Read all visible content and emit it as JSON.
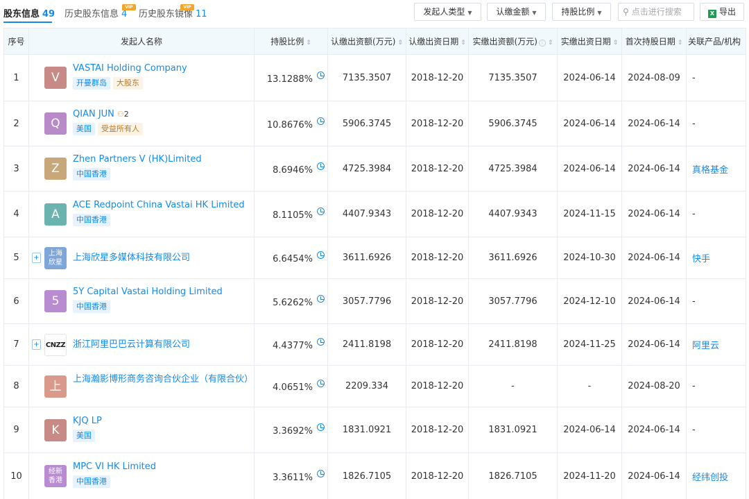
{
  "tabs": [
    {
      "label": "股东信息",
      "count": "49",
      "active": true
    },
    {
      "label": "历史股东信息",
      "count": "4",
      "vip": "VIP"
    },
    {
      "label": "历史股东镜像",
      "count": "11",
      "vip": "VIP"
    }
  ],
  "toolbar": {
    "filter_type": "发起人类型",
    "filter_amount": "认缴金额",
    "filter_ratio": "持股比例",
    "search_placeholder": "点击进行搜索",
    "export_label": "导出",
    "export_icon": "excel-icon"
  },
  "columns": [
    "序号",
    "发起人名称",
    "持股比例",
    "认缴出资额(万元)",
    "认缴出资日期",
    "实缴出资额(万元)",
    "实缴出资日期",
    "首次持股日期",
    "关联产品/机构"
  ],
  "rows": [
    {
      "index": "1",
      "logo_text": "V",
      "logo_color": "#c88a86",
      "name": "VASTAI Holding Company",
      "tags": [
        {
          "text": "开曼群岛",
          "style": "blue"
        },
        {
          "text": "大股东",
          "style": "gold"
        }
      ],
      "ratio": "13.1288%",
      "sub_amount": "7135.3507",
      "sub_date": "2018-12-20",
      "paid_amount": "7135.3507",
      "paid_date": "2024-06-14",
      "first_date": "2024-08-09",
      "related": "-"
    },
    {
      "index": "2",
      "logo_text": "Q",
      "logo_color": "#b88ac9",
      "name": "QIAN JUN",
      "person_count": "2",
      "tags": [
        {
          "text": "美国",
          "style": "blue"
        },
        {
          "text": "受益所有人",
          "style": "gold"
        }
      ],
      "ratio": "10.8676%",
      "sub_amount": "5906.3745",
      "sub_date": "2018-12-20",
      "paid_amount": "5906.3745",
      "paid_date": "2024-06-14",
      "first_date": "2024-06-14",
      "related": "-"
    },
    {
      "index": "3",
      "logo_text": "Z",
      "logo_color": "#c8a77a",
      "name": "Zhen Partners V (HK)Limited",
      "tags": [
        {
          "text": "中国香港",
          "style": "blue"
        }
      ],
      "ratio": "8.6946%",
      "sub_amount": "4725.3984",
      "sub_date": "2018-12-20",
      "paid_amount": "4725.3984",
      "paid_date": "2024-06-14",
      "first_date": "2024-06-14",
      "related": "真格基金"
    },
    {
      "index": "4",
      "logo_text": "A",
      "logo_color": "#6bb3ae",
      "name": "ACE Redpoint China Vastai HK Limited",
      "tags": [
        {
          "text": "中国香港",
          "style": "blue"
        }
      ],
      "ratio": "8.1105%",
      "sub_amount": "4407.9343",
      "sub_date": "2018-12-20",
      "paid_amount": "4407.9343",
      "paid_date": "2024-11-15",
      "first_date": "2024-06-14",
      "related": "-"
    },
    {
      "index": "5",
      "logo_text": "上海\n欣星",
      "logo_color": "#7ea6d8",
      "logo_small": true,
      "expand": "+",
      "name": "上海欣星多媒体科技有限公司",
      "tags": [],
      "ratio": "6.6454%",
      "sub_amount": "3611.6926",
      "sub_date": "2018-12-20",
      "paid_amount": "3611.6926",
      "paid_date": "2024-10-30",
      "first_date": "2024-06-14",
      "related": "快手"
    },
    {
      "index": "6",
      "logo_text": "5",
      "logo_color": "#b98bd0",
      "name": "5Y Capital Vastai Holding Limited",
      "tags": [
        {
          "text": "中国香港",
          "style": "blue"
        }
      ],
      "ratio": "5.6262%",
      "sub_amount": "3057.7796",
      "sub_date": "2018-12-20",
      "paid_amount": "3057.7796",
      "paid_date": "2024-12-10",
      "first_date": "2024-06-14",
      "related": "-"
    },
    {
      "index": "7",
      "logo_text": "CNZZ",
      "logo_color": "#ffffff",
      "logo_cnzz": true,
      "expand": "+",
      "name": "浙江阿里巴巴云计算有限公司",
      "tags": [],
      "ratio": "4.4377%",
      "sub_amount": "2411.8198",
      "sub_date": "2018-12-20",
      "paid_amount": "2411.8198",
      "paid_date": "2024-11-25",
      "first_date": "2024-06-14",
      "related": "阿里云"
    },
    {
      "index": "8",
      "logo_text": "上",
      "logo_color": "#d99a8c",
      "name": "上海瀚影博形商务咨询合伙企业（有限合伙）",
      "tags": [],
      "ratio": "4.0651%",
      "sub_amount": "2209.334",
      "sub_date": "2018-12-20",
      "paid_amount": "-",
      "paid_date": "-",
      "first_date": "2024-08-20",
      "related": "-"
    },
    {
      "index": "9",
      "logo_text": "K",
      "logo_color": "#c88a86",
      "name": "KJQ LP",
      "tags": [
        {
          "text": "美国",
          "style": "blue"
        }
      ],
      "ratio": "3.3692%",
      "sub_amount": "1831.0921",
      "sub_date": "2018-12-20",
      "paid_amount": "1831.0921",
      "paid_date": "2024-06-14",
      "first_date": "2024-06-14",
      "related": "-"
    },
    {
      "index": "10",
      "logo_text": "经新\n香港",
      "logo_color": "#b98bd0",
      "logo_small": true,
      "name": "MPC VI HK Limited",
      "tags": [
        {
          "text": "中国香港",
          "style": "blue"
        }
      ],
      "ratio": "3.3611%",
      "sub_amount": "1826.7105",
      "sub_date": "2018-12-20",
      "paid_amount": "1826.7105",
      "paid_date": "2024-11-20",
      "first_date": "2024-06-14",
      "related": "经纬创投"
    }
  ]
}
